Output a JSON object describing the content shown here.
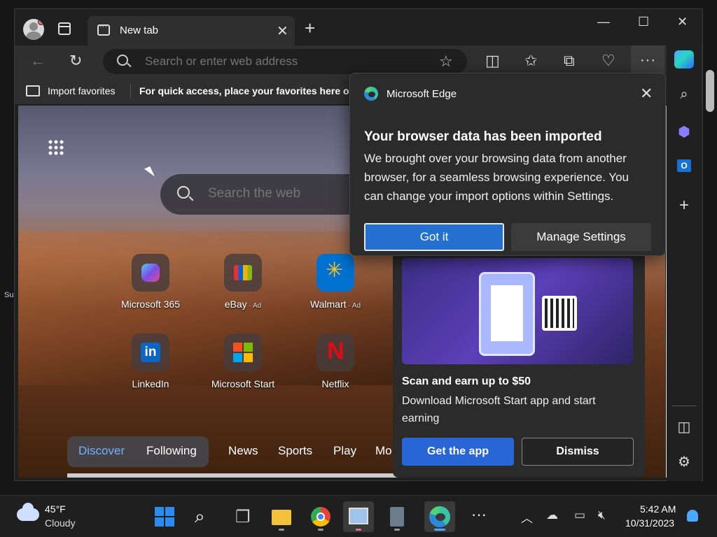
{
  "desktop": {
    "edge_label": "Su"
  },
  "tab": {
    "title": "New tab"
  },
  "address": {
    "placeholder": "Search or enter web address"
  },
  "favorites_bar": {
    "import_label": "Import favorites",
    "hint": "For quick access, place your favorites here o"
  },
  "new_tab_page": {
    "search_placeholder": "Search the web",
    "quick_links": [
      {
        "label": "Microsoft 365",
        "ad": ""
      },
      {
        "label": "eBay",
        "ad": " · Ad"
      },
      {
        "label": "Walmart",
        "ad": " · Ad"
      },
      {
        "label": "LinkedIn",
        "ad": ""
      },
      {
        "label": "Microsoft Start",
        "ad": ""
      },
      {
        "label": "Netflix",
        "ad": ""
      }
    ],
    "feed_tabs": [
      "Discover",
      "Following",
      "News",
      "Sports",
      "Play",
      "Mo"
    ]
  },
  "promo": {
    "title": "Scan and earn up to $50",
    "description": "Download Microsoft Start app and start earning",
    "primary_button": "Get the app",
    "secondary_button": "Dismiss"
  },
  "popup": {
    "app_name": "Microsoft Edge",
    "title": "Your browser data has been imported",
    "body": "We brought over your browsing data from another browser, for a seamless browsing experience. You can change your import options within Settings.",
    "primary_button": "Got it",
    "secondary_button": "Manage Settings"
  },
  "taskbar": {
    "weather_temp": "45°F",
    "weather_condition": "Cloudy",
    "time": "5:42 AM",
    "date": "10/31/2023"
  },
  "icons": {
    "accent_color": "#2370d0",
    "names": [
      "back-icon",
      "refresh-icon",
      "search-icon",
      "favorite-star-icon",
      "split-screen-icon",
      "favorites-icon",
      "collections-icon",
      "browser-essentials-icon",
      "more-icon",
      "copilot-icon",
      "edge-logo-icon",
      "close-icon",
      "apps-grid-icon"
    ]
  }
}
